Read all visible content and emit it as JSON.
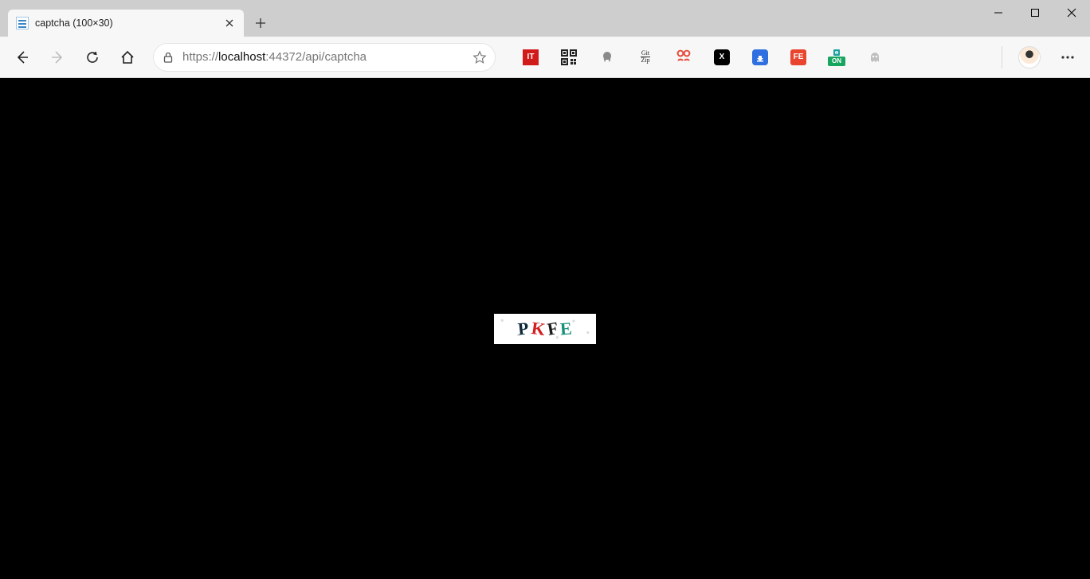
{
  "tab": {
    "title": "captcha (100×30)"
  },
  "address": {
    "scheme": "https://",
    "host": "localhost",
    "port_path": ":44372/api/captcha"
  },
  "extensions": [
    {
      "name": "it-extension",
      "label": "IT"
    },
    {
      "name": "qr-extension",
      "label": ""
    },
    {
      "name": "octotree-extension",
      "label": ""
    },
    {
      "name": "gitzip-extension",
      "label_top": "Git",
      "label_bot": "Zip"
    },
    {
      "name": "settings-extension",
      "label": ""
    },
    {
      "name": "x-extension",
      "label": "X"
    },
    {
      "name": "downloader-extension",
      "label": ""
    },
    {
      "name": "fe-extension",
      "label": "FE"
    },
    {
      "name": "on-extension",
      "label": "ON"
    },
    {
      "name": "ghost-extension",
      "label": ""
    }
  ],
  "captcha": {
    "letters": [
      {
        "char": "P",
        "color": "#0c2a3a",
        "rotate": "-6deg"
      },
      {
        "char": "K",
        "color": "#d21f1f",
        "rotate": "8deg"
      },
      {
        "char": "F",
        "color": "#1a1a1a",
        "rotate": "-10deg"
      },
      {
        "char": "E",
        "color": "#178f7a",
        "rotate": "-4deg"
      }
    ]
  }
}
